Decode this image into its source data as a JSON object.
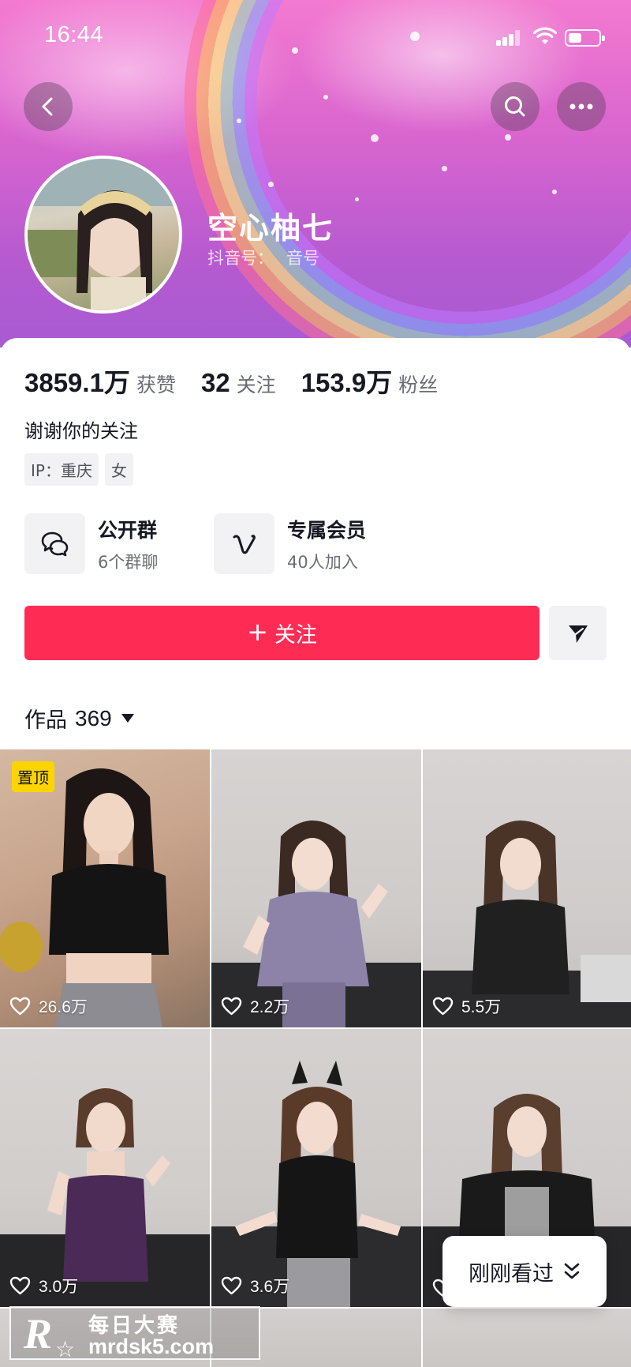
{
  "status_bar": {
    "time": "16:44"
  },
  "header": {
    "back_icon": "chevron-left-icon",
    "search_icon": "search-icon",
    "more_icon": "more-horizontal-icon",
    "username": "空心柚七",
    "douyin_id_label": "抖音号：",
    "douyin_id_value": "音号"
  },
  "stats": [
    {
      "value": "3859.1万",
      "label": "获赞"
    },
    {
      "value": "32",
      "label": "关注"
    },
    {
      "value": "153.9万",
      "label": "粉丝"
    }
  ],
  "bio": "谢谢你的关注",
  "tags": [
    "IP：重庆",
    "女"
  ],
  "features": [
    {
      "icon": "group-chat-icon",
      "title": "公开群",
      "subtitle": "6个群聊"
    },
    {
      "icon": "vip-v-icon",
      "title": "专属会员",
      "subtitle": "40人加入"
    }
  ],
  "actions": {
    "follow_label": "关注",
    "share_icon": "send-icon"
  },
  "works": {
    "label": "作品",
    "count": "369"
  },
  "videos": [
    {
      "likes": "26.6万",
      "pinned_label": "置顶"
    },
    {
      "likes": "2.2万"
    },
    {
      "likes": "5.5万"
    },
    {
      "likes": "3.0万"
    },
    {
      "likes": "3.6万"
    },
    {
      "likes": ""
    }
  ],
  "recent_button": {
    "label": "刚刚看过"
  },
  "watermark": {
    "logo": "R",
    "title": "每日大赛",
    "url": "mrdsk5.com"
  },
  "colors": {
    "accent": "#fe2c55",
    "pin_badge": "#fdd400"
  }
}
